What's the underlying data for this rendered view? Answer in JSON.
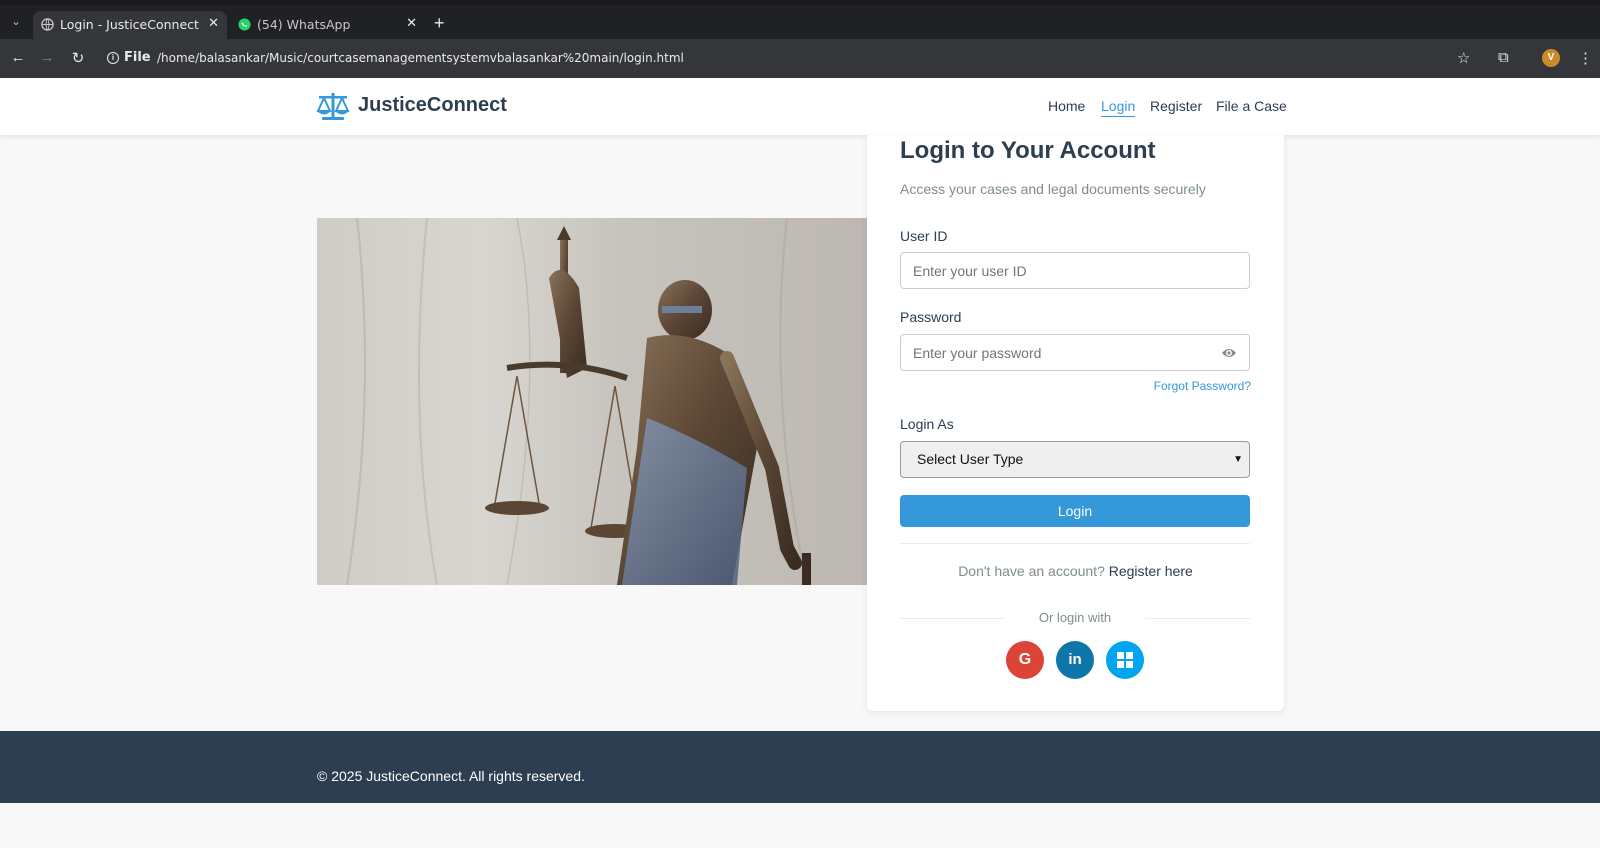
{
  "browser": {
    "tabs": [
      {
        "title": "Login - JusticeConnect",
        "active": true
      },
      {
        "title": "(54) WhatsApp",
        "active": false
      }
    ],
    "address": {
      "scheme_label": "File",
      "url": "/home/balasankar/Music/courtcasemanagementsystemvbalasankar%20main/login.html"
    },
    "profile_initial": "V"
  },
  "site": {
    "brand": "JusticeConnect",
    "nav": [
      {
        "label": "Home",
        "active": false
      },
      {
        "label": "Login",
        "active": true
      },
      {
        "label": "Register",
        "active": false
      },
      {
        "label": "File a Case",
        "active": false
      }
    ]
  },
  "login": {
    "title": "Login to Your Account",
    "subtitle": "Access your cases and legal documents securely",
    "userid_label": "User ID",
    "userid_placeholder": "Enter your user ID",
    "password_label": "Password",
    "password_placeholder": "Enter your password",
    "forgot": "Forgot Password?",
    "login_as_label": "Login As",
    "user_type_selected": "Select User Type",
    "login_button": "Login",
    "no_account_text": "Don't have an account?",
    "register_link": "Register here",
    "or_login_with": "Or login with",
    "social": [
      {
        "name": "google",
        "glyph": "G",
        "color": "#db4437"
      },
      {
        "name": "linkedin",
        "glyph": "in",
        "color": "#0e76a8"
      },
      {
        "name": "microsoft",
        "glyph": "",
        "color": "#00a4ef"
      }
    ]
  },
  "footer": {
    "copyright": "© 2025 JusticeConnect. All rights reserved."
  }
}
